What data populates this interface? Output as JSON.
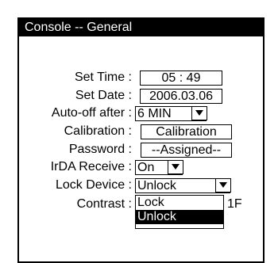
{
  "window": {
    "title": "Console -- General"
  },
  "fields": {
    "set_time": {
      "label": "Set Time :",
      "value": "05 : 49"
    },
    "set_date": {
      "label": "Set Date :",
      "value": "2006.03.06"
    },
    "auto_off": {
      "label": "Auto-off after :",
      "value": "6 MIN"
    },
    "calibration": {
      "label": "Calibration :",
      "button": "Calibration"
    },
    "password": {
      "label": "Password :",
      "value": "--Assigned--"
    },
    "irda": {
      "label": "IrDA Receive :",
      "value": "On"
    },
    "lock_device": {
      "label": "Lock Device :",
      "value": "Unlock",
      "options": [
        "Lock",
        "Unlock"
      ]
    },
    "contrast": {
      "label": "Contrast :",
      "value": "1F"
    }
  }
}
